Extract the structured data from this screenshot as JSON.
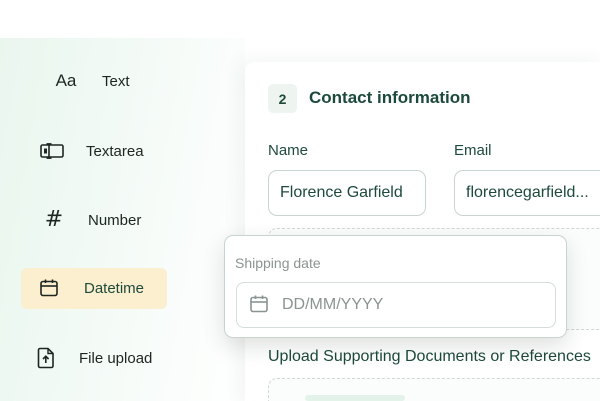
{
  "field_types": [
    {
      "label": "Text",
      "icon": "text-aa-icon",
      "active": false
    },
    {
      "label": "Textarea",
      "icon": "textarea-icon",
      "active": false
    },
    {
      "label": "Number",
      "icon": "hash-icon",
      "active": false
    },
    {
      "label": "Datetime",
      "icon": "calendar-icon",
      "active": true
    },
    {
      "label": "File upload",
      "icon": "file-upload-icon",
      "active": false
    }
  ],
  "form": {
    "step_number": "2",
    "section_title": "Contact information",
    "name_label": "Name",
    "name_value": "Florence Garfield",
    "email_label": "Email",
    "email_value": "florencegarfield...",
    "upload_title": "Upload Supporting Documents or References"
  },
  "popup": {
    "label": "Shipping date",
    "placeholder": "DD/MM/YYYY"
  },
  "colors": {
    "accent": "#1d4a3a",
    "active_bg": "#fbefcf",
    "sidebar_tint": "#e9f6ee"
  }
}
